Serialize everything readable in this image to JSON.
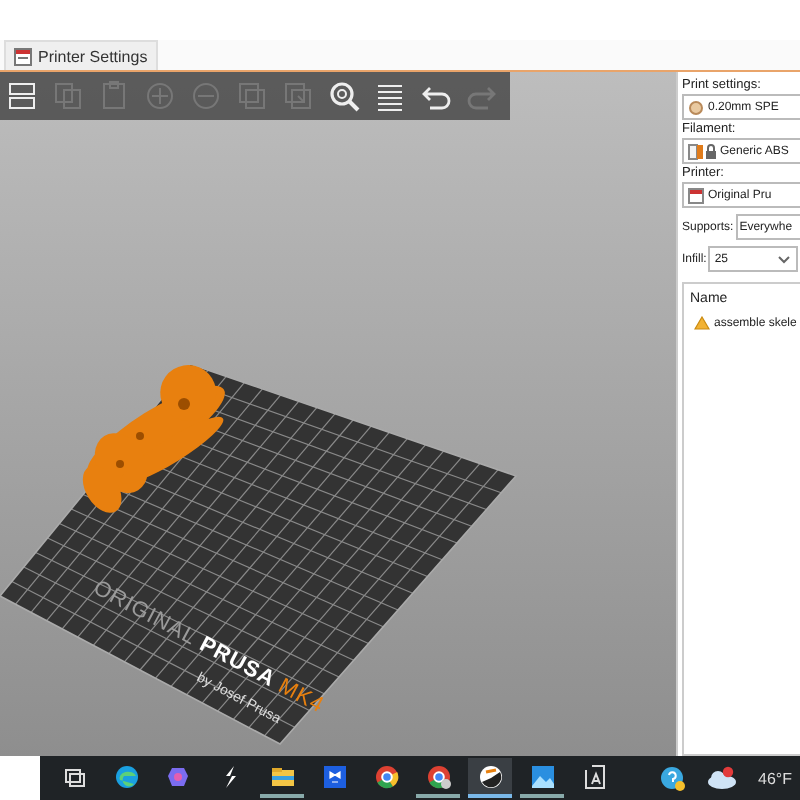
{
  "tabs": [
    {
      "label": "Printer Settings",
      "selected": true
    }
  ],
  "toolbar": [
    {
      "kind": "layout",
      "disabled": false
    },
    {
      "kind": "copy",
      "disabled": true
    },
    {
      "kind": "paste",
      "disabled": true
    },
    {
      "kind": "add",
      "disabled": true
    },
    {
      "kind": "remove",
      "disabled": true
    },
    {
      "kind": "instance",
      "disabled": true
    },
    {
      "kind": "split",
      "disabled": true
    },
    {
      "kind": "search",
      "disabled": false
    },
    {
      "kind": "layers",
      "disabled": false
    },
    {
      "kind": "undo",
      "disabled": false
    },
    {
      "kind": "redo",
      "disabled": true
    }
  ],
  "bed": {
    "brand_prefix": "ORIGINAL",
    "brand": "PRUSA",
    "model": "MK4",
    "maker": "by Josef Prusa"
  },
  "sidebar": {
    "print_settings": {
      "label": "Print settings:",
      "value": "0.20mm SPE"
    },
    "filament": {
      "label": "Filament:",
      "value": "Generic ABS"
    },
    "printer": {
      "label": "Printer:",
      "value": "Original Pru"
    },
    "supports": {
      "label": "Supports:",
      "value": "Everywhe"
    },
    "infill": {
      "label": "Infill:",
      "value": "25"
    },
    "object_list": {
      "header": "Name",
      "items": [
        {
          "name": "assemble skele",
          "warning": true
        }
      ]
    }
  },
  "taskbar": {
    "apps": [
      {
        "kind": "taskview",
        "running": false,
        "selected": false
      },
      {
        "kind": "edge",
        "running": false,
        "selected": false
      },
      {
        "kind": "copilot",
        "running": false,
        "selected": false
      },
      {
        "kind": "bolt",
        "running": false,
        "selected": false
      },
      {
        "kind": "folder",
        "running": true,
        "selected": false
      },
      {
        "kind": "dropbox",
        "running": false,
        "selected": false
      },
      {
        "kind": "chrome",
        "running": false,
        "selected": false
      },
      {
        "kind": "chrome2",
        "running": true,
        "selected": false
      },
      {
        "kind": "slicer",
        "running": true,
        "selected": true
      },
      {
        "kind": "photos",
        "running": true,
        "selected": false
      },
      {
        "kind": "reader",
        "running": false,
        "selected": false
      }
    ],
    "tray": {
      "temperature": "46°F"
    }
  }
}
